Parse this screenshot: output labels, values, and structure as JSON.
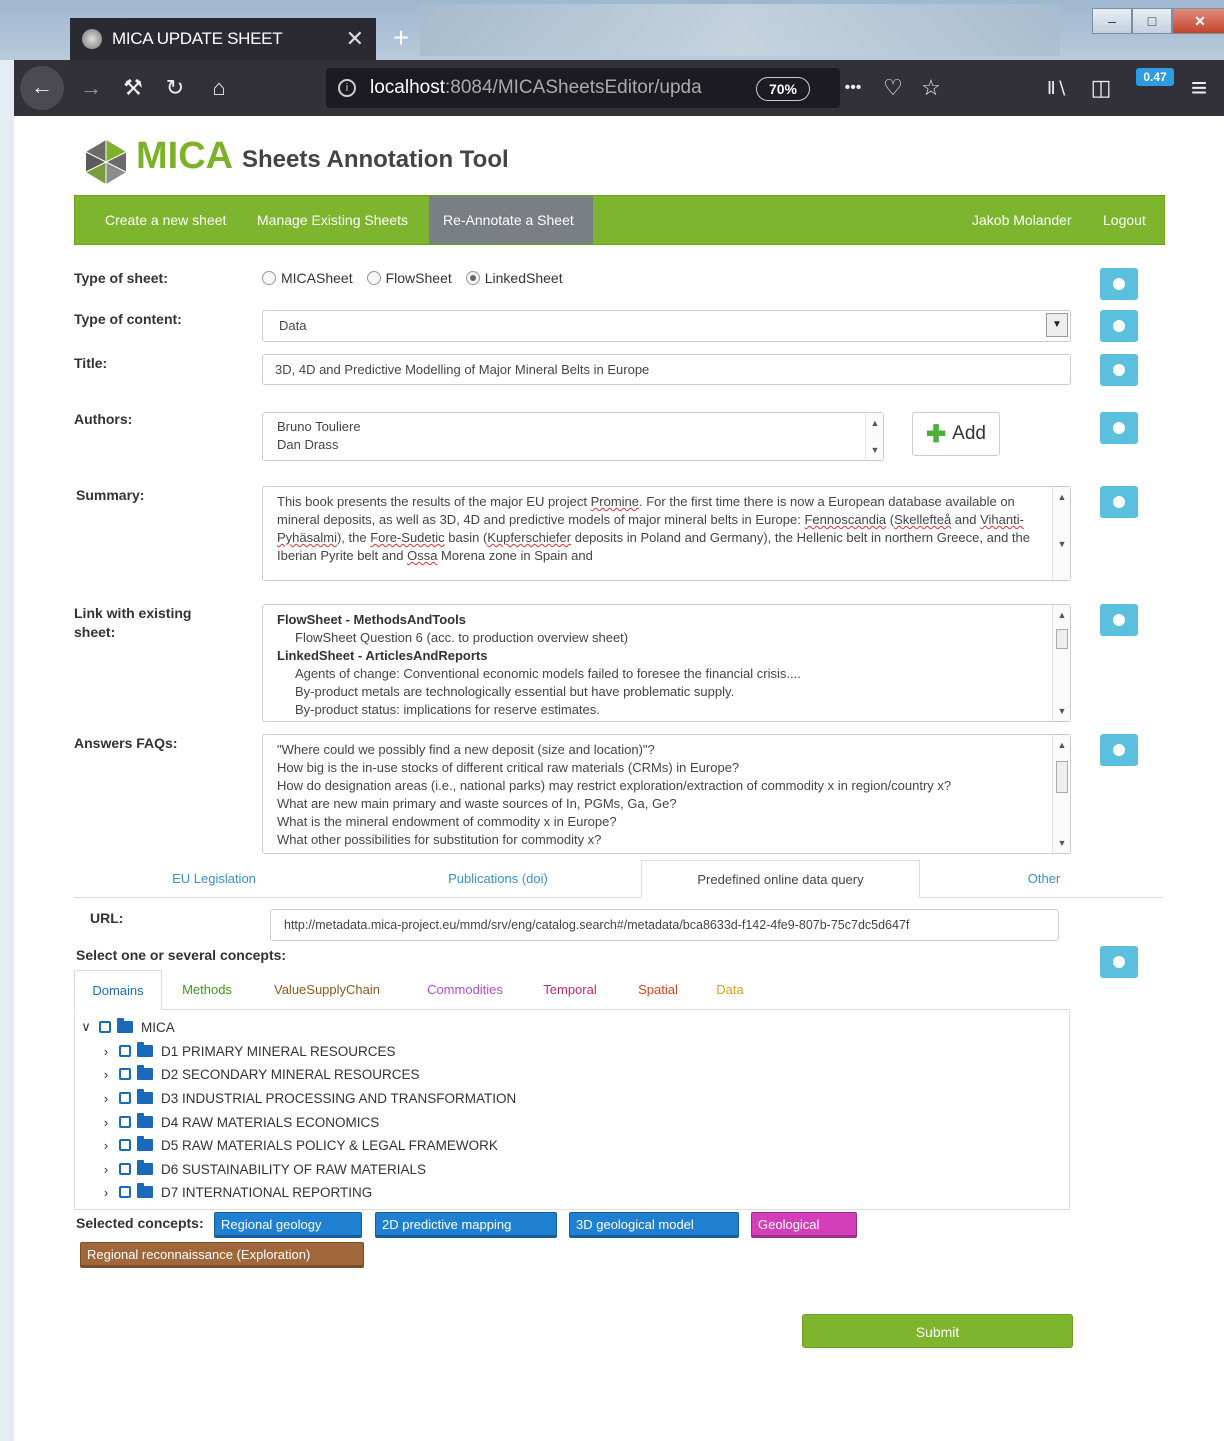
{
  "browser": {
    "tab_title": "MICA UPDATE SHEET",
    "new_tab": "+",
    "url_host": "localhost",
    "url_path": ":8084/MICASheetsEditor/upda",
    "zoom": "70%",
    "more": "•••",
    "ext_badge": "0.47",
    "window_buttons": {
      "minimize": "–",
      "restore": "□",
      "close": "✕"
    }
  },
  "header": {
    "brand": "MICA",
    "subtitle": "Sheets Annotation Tool"
  },
  "menu": {
    "create": "Create a new sheet",
    "manage": "Manage Existing Sheets",
    "reannotate": "Re-Annotate a Sheet",
    "user": "Jakob Molander",
    "logout": "Logout"
  },
  "form": {
    "type_of_sheet_label": "Type of sheet:",
    "sheet_types": [
      "MICASheet",
      "FlowSheet",
      "LinkedSheet"
    ],
    "selected_sheet_type": "LinkedSheet",
    "type_of_content_label": "Type of content:",
    "type_of_content_value": "Data",
    "title_label": "Title:",
    "title_value": "3D, 4D and Predictive Modelling of Major Mineral Belts in Europe",
    "authors_label": "Authors:",
    "authors": [
      "Bruno Touliere",
      "Dan Drass"
    ],
    "add_button": "Add",
    "summary_label": "Summary:",
    "summary_parts": [
      "This book presents the results of the major EU project ",
      "Promine",
      ". For the first time there is now a European database available on mineral deposits, as well as 3D, 4D and predictive models of major mineral belts in Europe: ",
      "Fennoscandia",
      " (",
      "Skellefteå",
      " and ",
      "Vihanti-Pyhäsalmi",
      "), the ",
      "Fore-Sudetic",
      " basin (",
      "Kupferschiefer",
      " deposits in Poland and Germany), the Hellenic belt in northern Greece, and the Iberian Pyrite belt and ",
      "Ossa",
      " Morena zone in Spain and"
    ],
    "link_label": "Link with existing sheet:",
    "link_items": [
      {
        "text": "FlowSheet - MethodsAndTools",
        "group": true
      },
      {
        "text": "FlowSheet Question 6 (acc. to production overview sheet)",
        "group": false
      },
      {
        "text": "LinkedSheet - ArticlesAndReports",
        "group": true
      },
      {
        "text": "Agents of change: Conventional economic models failed to foresee the financial crisis....",
        "group": false
      },
      {
        "text": "By-product metals are technologically essential but have problematic supply.",
        "group": false
      },
      {
        "text": "By-product status: implications for reserve estimates.",
        "group": false
      }
    ],
    "faqs_label": "Answers FAQs:",
    "faqs": [
      "\"Where could we possibly find a new deposit (size and location)\"?",
      "How big is the in-use stocks of different critical raw materials (CRMs) in Europe?",
      "How do designation areas (i.e., national parks) may restrict exploration/extraction of commodity x in region/country x?",
      "What are new main primary and waste sources of In, PGMs, Ga, Ge?",
      "What is the mineral endowment of commodity x in Europe?",
      "What other possibilities for substitution for commodity x?"
    ]
  },
  "resource_tabs": [
    "EU Legislation",
    "Publications (doi)",
    "Predefined online data query",
    "Other"
  ],
  "url_label": "URL:",
  "url_value": "http://metadata.mica-project.eu/mmd/srv/eng/catalog.search#/metadata/bca8633d-f142-4fe9-807b-75c7dc5d647f",
  "concepts_label": "Select one or several concepts:",
  "concept_tabs": [
    {
      "label": "Domains",
      "color": "#1a6ab8"
    },
    {
      "label": "Methods",
      "color": "#3a9a1f"
    },
    {
      "label": "ValueSupplyChain",
      "color": "#8a5a1a"
    },
    {
      "label": "Commodities",
      "color": "#b04fc8"
    },
    {
      "label": "Temporal",
      "color": "#c8256a"
    },
    {
      "label": "Spatial",
      "color": "#e0401a"
    },
    {
      "label": "Data",
      "color": "#e0a020"
    }
  ],
  "tree": {
    "root": "MICA",
    "chevron_open": "∨",
    "chevron_closed": "›",
    "items": [
      "D1 PRIMARY MINERAL RESOURCES",
      "D2 SECONDARY MINERAL RESOURCES",
      "D3 INDUSTRIAL PROCESSING AND TRANSFORMATION",
      "D4 RAW MATERIALS ECONOMICS",
      "D5 RAW MATERIALS POLICY & LEGAL FRAMEWORK",
      "D6 SUSTAINABILITY OF RAW MATERIALS",
      "D7 INTERNATIONAL REPORTING"
    ]
  },
  "selected_label": "Selected concepts:",
  "selected_concepts": [
    {
      "label": "Regional geology",
      "color": "#1f7fd0"
    },
    {
      "label": "2D predictive mapping",
      "color": "#1f7fd0"
    },
    {
      "label": "3D geological model",
      "color": "#1f7fd0"
    },
    {
      "label": "Geological",
      "color": "#d23fb8"
    },
    {
      "label": "Regional reconnaissance (Exploration)",
      "color": "#a0683a"
    }
  ],
  "submit": "Submit",
  "icons": {
    "back": "←",
    "forward": "→",
    "wrench": "⚒",
    "reload": "↻",
    "home": "⌂",
    "library": "Ⅱ∖",
    "sidebar": "◫",
    "menu": "≡",
    "star": "☆",
    "pocket": "♡",
    "info": "i",
    "plus": "✚",
    "tab_close": "✕",
    "dropdown": "▼",
    "scroll_up": "▲",
    "scroll_down": "▼"
  }
}
